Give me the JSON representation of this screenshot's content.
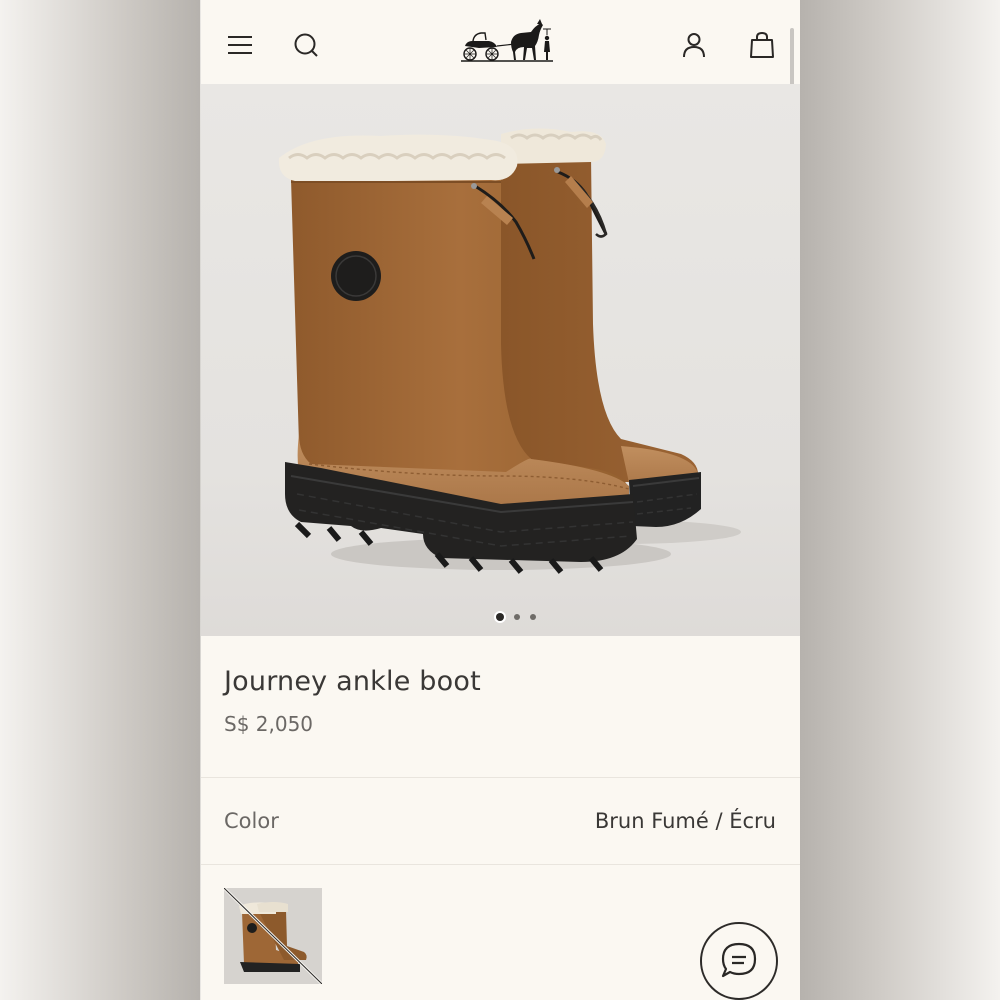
{
  "header": {
    "menu_icon": "hamburger-menu-icon",
    "search_icon": "search-icon",
    "logo": "carriage-horse-logo",
    "account_icon": "user-icon",
    "bag_icon": "shopping-bag-icon"
  },
  "gallery": {
    "image": "tan suede boots with shearling cuff",
    "slides": 3,
    "active_slide": 1
  },
  "product": {
    "name": "Journey ankle boot",
    "price": "S$ 2,050"
  },
  "color_selector": {
    "label": "Color",
    "value": "Brun Fumé / Écru"
  },
  "swatches": [
    {
      "name": "Brun Fumé / Écru",
      "selected": true,
      "crossed_out": true
    }
  ],
  "chat": {
    "icon": "chat-bubble-icon"
  },
  "colors": {
    "page_bg": "#fbf8f2",
    "text_primary": "#3a3836",
    "text_secondary": "#6b6865",
    "suede": "#a06a38",
    "sole": "#222222"
  }
}
